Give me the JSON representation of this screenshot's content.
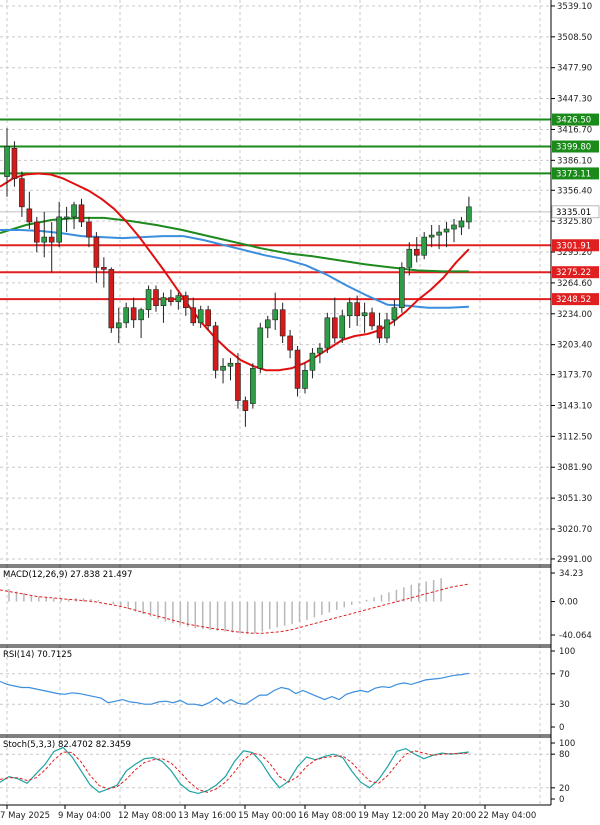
{
  "chart_data": {
    "type": "candlestick",
    "colors": {
      "bull": "#2e9e46",
      "bear": "#d41b1b",
      "ma_fast": "#e01010",
      "ma_mid": "#3b8ede",
      "ma_slow": "#1d8a1d",
      "level_green": "#1a8a1a",
      "level_red": "#e02020",
      "grid": "#c9c9c9",
      "macd_signal": "#e02020",
      "rsi": "#3b8ede",
      "stoch_k": "#1fa3a3",
      "stoch_d": "#e02020"
    },
    "price_axis": {
      "min": 2985,
      "max": 3545,
      "ticks": [
        "3539.10",
        "3508.50",
        "3477.90",
        "3447.30",
        "3416.70",
        "3386.10",
        "3356.40",
        "3325.80",
        "3295.20",
        "3264.60",
        "3234.00",
        "3203.40",
        "3173.70",
        "3143.10",
        "3112.50",
        "3081.90",
        "3051.30",
        "3020.70",
        "2991.00"
      ]
    },
    "time_labels": [
      "7 May 2025",
      "9 May 04:00",
      "12 May 08:00",
      "13 May 16:00",
      "15 May 00:00",
      "16 May 08:00",
      "19 May 12:00",
      "20 May 20:00",
      "22 May 04:00"
    ],
    "levels": [
      {
        "label": "3426.50",
        "value": 3426.5,
        "color": "green"
      },
      {
        "label": "3399.80",
        "value": 3399.8,
        "color": "green"
      },
      {
        "label": "3373.11",
        "value": 3373.11,
        "color": "green"
      },
      {
        "label": "3301.91",
        "value": 3301.91,
        "color": "red"
      },
      {
        "label": "3275.22",
        "value": 3275.22,
        "color": "red"
      },
      {
        "label": "3248.52",
        "value": 3248.52,
        "color": "red"
      }
    ],
    "current_price": {
      "label": "3335.01",
      "value": 3335.01
    },
    "candles": [
      {
        "o": 3370,
        "h": 3418,
        "l": 3350,
        "c": 3400
      },
      {
        "o": 3398,
        "h": 3405,
        "l": 3360,
        "c": 3368
      },
      {
        "o": 3368,
        "h": 3375,
        "l": 3330,
        "c": 3340
      },
      {
        "o": 3338,
        "h": 3355,
        "l": 3318,
        "c": 3325
      },
      {
        "o": 3325,
        "h": 3330,
        "l": 3295,
        "c": 3305
      },
      {
        "o": 3305,
        "h": 3335,
        "l": 3290,
        "c": 3310
      },
      {
        "o": 3310,
        "h": 3325,
        "l": 3275,
        "c": 3305
      },
      {
        "o": 3305,
        "h": 3345,
        "l": 3300,
        "c": 3330
      },
      {
        "o": 3330,
        "h": 3340,
        "l": 3315,
        "c": 3330
      },
      {
        "o": 3330,
        "h": 3345,
        "l": 3318,
        "c": 3342
      },
      {
        "o": 3342,
        "h": 3348,
        "l": 3320,
        "c": 3325
      },
      {
        "o": 3325,
        "h": 3330,
        "l": 3300,
        "c": 3310
      },
      {
        "o": 3310,
        "h": 3315,
        "l": 3265,
        "c": 3280
      },
      {
        "o": 3280,
        "h": 3290,
        "l": 3260,
        "c": 3278
      },
      {
        "o": 3278,
        "h": 3280,
        "l": 3215,
        "c": 3220
      },
      {
        "o": 3220,
        "h": 3240,
        "l": 3205,
        "c": 3225
      },
      {
        "o": 3225,
        "h": 3245,
        "l": 3220,
        "c": 3240
      },
      {
        "o": 3240,
        "h": 3250,
        "l": 3220,
        "c": 3228
      },
      {
        "o": 3228,
        "h": 3240,
        "l": 3210,
        "c": 3238
      },
      {
        "o": 3238,
        "h": 3262,
        "l": 3230,
        "c": 3258
      },
      {
        "o": 3258,
        "h": 3262,
        "l": 3236,
        "c": 3242
      },
      {
        "o": 3242,
        "h": 3255,
        "l": 3225,
        "c": 3250
      },
      {
        "o": 3250,
        "h": 3258,
        "l": 3242,
        "c": 3246
      },
      {
        "o": 3246,
        "h": 3255,
        "l": 3238,
        "c": 3252
      },
      {
        "o": 3252,
        "h": 3256,
        "l": 3232,
        "c": 3240
      },
      {
        "o": 3240,
        "h": 3250,
        "l": 3222,
        "c": 3225
      },
      {
        "o": 3225,
        "h": 3242,
        "l": 3220,
        "c": 3238
      },
      {
        "o": 3238,
        "h": 3242,
        "l": 3218,
        "c": 3222
      },
      {
        "o": 3222,
        "h": 3226,
        "l": 3170,
        "c": 3178
      },
      {
        "o": 3178,
        "h": 3190,
        "l": 3165,
        "c": 3182
      },
      {
        "o": 3182,
        "h": 3190,
        "l": 3168,
        "c": 3185
      },
      {
        "o": 3185,
        "h": 3195,
        "l": 3140,
        "c": 3148
      },
      {
        "o": 3148,
        "h": 3152,
        "l": 3122,
        "c": 3138
      },
      {
        "o": 3145,
        "h": 3185,
        "l": 3140,
        "c": 3180
      },
      {
        "o": 3180,
        "h": 3225,
        "l": 3175,
        "c": 3220
      },
      {
        "o": 3220,
        "h": 3232,
        "l": 3210,
        "c": 3228
      },
      {
        "o": 3228,
        "h": 3255,
        "l": 3218,
        "c": 3238
      },
      {
        "o": 3238,
        "h": 3245,
        "l": 3205,
        "c": 3212
      },
      {
        "o": 3212,
        "h": 3218,
        "l": 3190,
        "c": 3198
      },
      {
        "o": 3198,
        "h": 3202,
        "l": 3152,
        "c": 3160
      },
      {
        "o": 3160,
        "h": 3185,
        "l": 3155,
        "c": 3178
      },
      {
        "o": 3178,
        "h": 3200,
        "l": 3170,
        "c": 3195
      },
      {
        "o": 3195,
        "h": 3205,
        "l": 3185,
        "c": 3200
      },
      {
        "o": 3200,
        "h": 3235,
        "l": 3195,
        "c": 3230
      },
      {
        "o": 3230,
        "h": 3250,
        "l": 3205,
        "c": 3210
      },
      {
        "o": 3210,
        "h": 3238,
        "l": 3205,
        "c": 3232
      },
      {
        "o": 3232,
        "h": 3250,
        "l": 3220,
        "c": 3245
      },
      {
        "o": 3245,
        "h": 3252,
        "l": 3222,
        "c": 3232
      },
      {
        "o": 3232,
        "h": 3245,
        "l": 3215,
        "c": 3235
      },
      {
        "o": 3235,
        "h": 3240,
        "l": 3218,
        "c": 3222
      },
      {
        "o": 3222,
        "h": 3235,
        "l": 3205,
        "c": 3210
      },
      {
        "o": 3210,
        "h": 3235,
        "l": 3205,
        "c": 3228
      },
      {
        "o": 3228,
        "h": 3248,
        "l": 3222,
        "c": 3240
      },
      {
        "o": 3240,
        "h": 3285,
        "l": 3235,
        "c": 3280
      },
      {
        "o": 3280,
        "h": 3305,
        "l": 3272,
        "c": 3298
      },
      {
        "o": 3298,
        "h": 3310,
        "l": 3285,
        "c": 3292
      },
      {
        "o": 3292,
        "h": 3315,
        "l": 3288,
        "c": 3310
      },
      {
        "o": 3310,
        "h": 3322,
        "l": 3300,
        "c": 3312
      },
      {
        "o": 3312,
        "h": 3322,
        "l": 3298,
        "c": 3315
      },
      {
        "o": 3315,
        "h": 3325,
        "l": 3300,
        "c": 3318
      },
      {
        "o": 3318,
        "h": 3328,
        "l": 3305,
        "c": 3322
      },
      {
        "o": 3320,
        "h": 3330,
        "l": 3312,
        "c": 3326
      },
      {
        "o": 3325,
        "h": 3350,
        "l": 3318,
        "c": 3340
      }
    ],
    "ma_fast": [
      3360,
      3368,
      3372,
      3373,
      3372,
      3368,
      3362,
      3356,
      3348,
      3338,
      3325,
      3310,
      3293,
      3276,
      3258,
      3240,
      3224,
      3210,
      3198,
      3188,
      3182,
      3178,
      3178,
      3180,
      3185,
      3192,
      3200,
      3208,
      3212,
      3214,
      3218,
      3226,
      3236,
      3248,
      3258,
      3270,
      3285,
      3298
    ],
    "ma_mid": [
      3317,
      3317,
      3316,
      3314,
      3311,
      3310,
      3309,
      3310,
      3311,
      3311,
      3307,
      3302,
      3297,
      3292,
      3288,
      3282,
      3273,
      3262,
      3252,
      3243,
      3242,
      3240,
      3240,
      3241
    ],
    "ma_slow": [
      3314,
      3322,
      3327,
      3329,
      3329,
      3326,
      3322,
      3317,
      3311,
      3305,
      3299,
      3294,
      3291,
      3287,
      3283,
      3280,
      3277,
      3276,
      3276
    ],
    "macd": {
      "label": "MACD(12,26,9) 27.838 21.497",
      "ticks": [
        "34.23",
        "0.00",
        "-40.064"
      ],
      "min": -40.064,
      "max": 34.23,
      "hist": [
        15,
        12,
        10,
        8,
        6,
        5,
        4,
        3,
        3,
        4,
        4,
        3,
        2,
        0,
        -3,
        -6,
        -9,
        -12,
        -15,
        -18,
        -21,
        -24,
        -26,
        -28,
        -30,
        -32,
        -33,
        -34,
        -35,
        -36,
        -37,
        -38,
        -39,
        -38,
        -36,
        -33,
        -31,
        -29,
        -27,
        -25,
        -22,
        -19,
        -16,
        -13,
        -10,
        -7,
        -4,
        -1,
        2,
        5,
        8,
        11,
        14,
        17,
        20,
        22,
        24,
        26,
        28
      ],
      "signal": [
        14,
        12,
        10,
        8,
        6,
        5,
        4,
        3,
        2,
        1,
        0,
        -2,
        -4,
        -6,
        -9,
        -12,
        -15,
        -18,
        -21,
        -24,
        -27,
        -29,
        -31,
        -33,
        -34,
        -36,
        -37,
        -38,
        -38,
        -37,
        -36,
        -34,
        -31,
        -28,
        -25,
        -22,
        -19,
        -16,
        -13,
        -10,
        -7,
        -4,
        -1,
        2,
        5,
        8,
        11,
        14,
        17,
        19,
        21
      ]
    },
    "rsi": {
      "label": "RSI(14) 70.7125",
      "ticks": [
        "100",
        "70",
        "30",
        "0"
      ],
      "values": [
        60,
        56,
        54,
        52,
        52,
        50,
        48,
        46,
        44,
        43,
        45,
        44,
        42,
        40,
        38,
        32,
        34,
        36,
        33,
        32,
        30,
        30,
        33,
        34,
        32,
        35,
        30,
        30,
        28,
        32,
        38,
        31,
        36,
        31,
        30,
        36,
        42,
        42,
        48,
        52,
        50,
        44,
        48,
        44,
        40,
        36,
        40,
        36,
        43,
        46,
        48,
        46,
        51,
        53,
        52,
        56,
        58,
        56,
        59,
        62,
        63,
        64,
        66,
        68,
        69,
        70.7
      ]
    },
    "stoch": {
      "label": "Stoch(5,3,3) 82.4702 82.3459",
      "ticks": [
        "100",
        "80",
        "20",
        "0"
      ],
      "k": [
        30,
        40,
        36,
        28,
        45,
        62,
        85,
        92,
        75,
        50,
        25,
        12,
        18,
        25,
        50,
        62,
        72,
        74,
        67,
        50,
        27,
        14,
        10,
        15,
        25,
        40,
        67,
        86,
        83,
        65,
        40,
        20,
        32,
        58,
        75,
        70,
        76,
        80,
        74,
        50,
        30,
        20,
        35,
        58,
        85,
        90,
        80,
        72,
        78,
        82,
        80,
        82,
        84
      ],
      "d": [
        35,
        38,
        38,
        33,
        38,
        52,
        70,
        84,
        83,
        66,
        42,
        24,
        18,
        22,
        35,
        52,
        65,
        70,
        72,
        64,
        48,
        30,
        17,
        12,
        18,
        30,
        48,
        70,
        82,
        78,
        62,
        40,
        30,
        40,
        58,
        70,
        74,
        76,
        77,
        65,
        48,
        32,
        28,
        42,
        62,
        80,
        86,
        82,
        78,
        80,
        81,
        81,
        82
      ]
    }
  }
}
